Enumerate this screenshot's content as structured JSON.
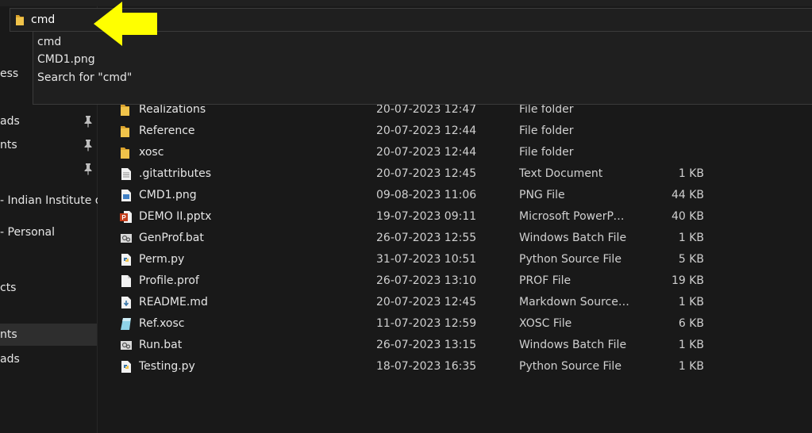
{
  "address": {
    "value": "cmd"
  },
  "suggestions": [
    "cmd",
    "CMD1.png",
    "Search for \"cmd\""
  ],
  "sidebar": {
    "items": [
      {
        "label": "ess"
      },
      {
        "label": "ads"
      },
      {
        "label": "nts"
      },
      {
        "label": ""
      },
      {
        "label": "- Indian Institute of"
      },
      {
        "label": "- Personal"
      },
      {
        "label": "cts"
      },
      {
        "label": "nts"
      },
      {
        "label": "ads"
      }
    ]
  },
  "files": [
    {
      "name": "Realizations",
      "date": "20-07-2023 12:47",
      "type": "File folder",
      "size": "",
      "icon": "folder-icon"
    },
    {
      "name": "Reference",
      "date": "20-07-2023 12:44",
      "type": "File folder",
      "size": "",
      "icon": "folder-icon"
    },
    {
      "name": "xosc",
      "date": "20-07-2023 12:44",
      "type": "File folder",
      "size": "",
      "icon": "folder-icon"
    },
    {
      "name": ".gitattributes",
      "date": "20-07-2023 12:45",
      "type": "Text Document",
      "size": "1 KB",
      "icon": "text-file-icon"
    },
    {
      "name": "CMD1.png",
      "date": "09-08-2023 11:06",
      "type": "PNG File",
      "size": "44 KB",
      "icon": "image-file-icon"
    },
    {
      "name": "DEMO II.pptx",
      "date": "19-07-2023 09:11",
      "type": "Microsoft PowerPo...",
      "size": "40 KB",
      "icon": "powerpoint-file-icon"
    },
    {
      "name": "GenProf.bat",
      "date": "26-07-2023 12:55",
      "type": "Windows Batch File",
      "size": "1 KB",
      "icon": "batch-file-icon"
    },
    {
      "name": "Perm.py",
      "date": "31-07-2023 10:51",
      "type": "Python Source File",
      "size": "5 KB",
      "icon": "python-file-icon"
    },
    {
      "name": "Profile.prof",
      "date": "26-07-2023 13:10",
      "type": "PROF File",
      "size": "19 KB",
      "icon": "blank-file-icon"
    },
    {
      "name": "README.md",
      "date": "20-07-2023 12:45",
      "type": "Markdown Source ...",
      "size": "1 KB",
      "icon": "markdown-file-icon"
    },
    {
      "name": "Ref.xosc",
      "date": "11-07-2023 12:59",
      "type": "XOSC File",
      "size": "6 KB",
      "icon": "xosc-file-icon"
    },
    {
      "name": "Run.bat",
      "date": "26-07-2023 13:15",
      "type": "Windows Batch File",
      "size": "1 KB",
      "icon": "batch-file-icon"
    },
    {
      "name": "Testing.py",
      "date": "18-07-2023 16:35",
      "type": "Python Source File",
      "size": "1 KB",
      "icon": "python-file-icon"
    }
  ],
  "colors": {
    "background": "#191919",
    "folder": "#f0c34a",
    "arrow": "#ffff00",
    "powerpoint": "#c43e1c",
    "python": "#3b77a8"
  }
}
